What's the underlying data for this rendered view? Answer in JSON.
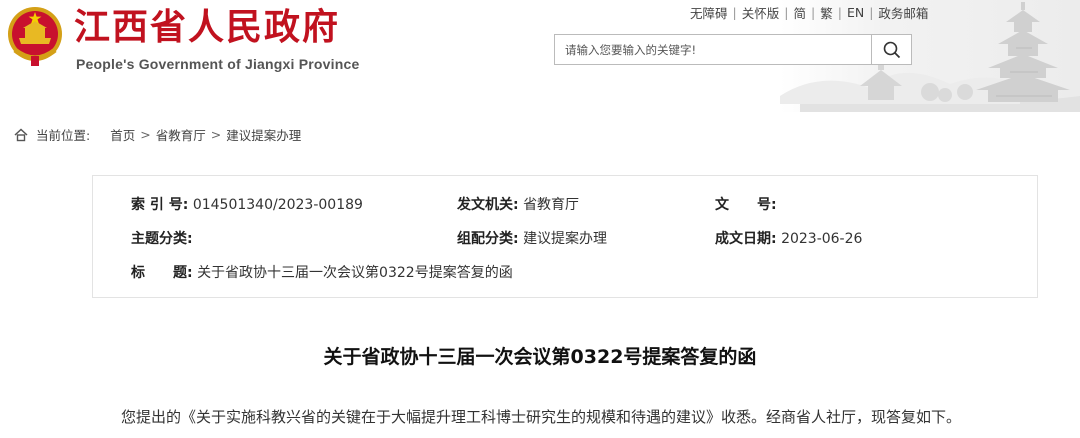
{
  "header": {
    "site_title": "江西省人民政府",
    "site_subtitle": "People's Government of Jiangxi Province",
    "emblem_icon": "national-emblem-icon",
    "top_links": [
      "无障碍",
      "关怀版",
      "简",
      "繁",
      "EN",
      "政务邮箱"
    ],
    "search": {
      "placeholder": "请输入您要输入的关键字!",
      "button_icon": "search-icon"
    },
    "colors": {
      "title_red": "#c1121f"
    }
  },
  "breadcrumb": {
    "label": "当前位置:",
    "items": [
      "首页",
      "省教育厅",
      "建议提案办理"
    ],
    "separator": ">"
  },
  "info": {
    "index_key": "索 引 号:",
    "index_value": "014501340/2023-00189",
    "issuer_key": "发文机关:",
    "issuer_value": "省教育厅",
    "doc_no_key": "文　　号:",
    "doc_no_value": "",
    "topic_key": "主题分类:",
    "topic_value": "",
    "group_key": "组配分类:",
    "group_value": "建议提案办理",
    "date_key": "成文日期:",
    "date_value": "2023-06-26",
    "title_key": "标　　题:",
    "title_value": "关于省政协十三届一次会议第0322号提案答复的函"
  },
  "article": {
    "title": "关于省政协十三届一次会议第0322号提案答复的函",
    "paragraph_1": "您提出的《关于实施科教兴省的关键在于大幅提升理工科博士研究生的规模和待遇的建议》收悉。经商省人社厅，现答复如下。"
  }
}
